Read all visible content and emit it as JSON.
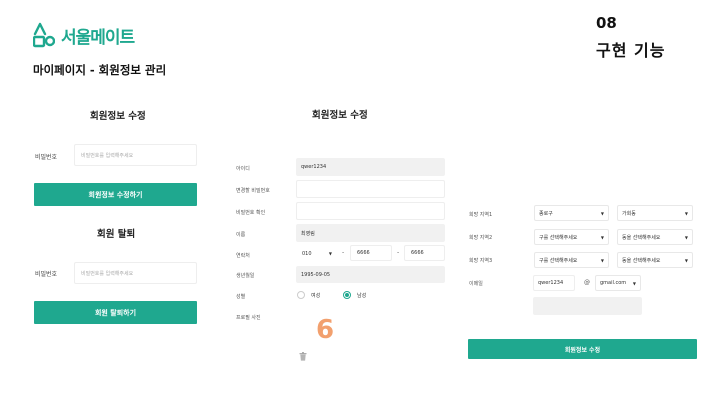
{
  "brand": {
    "name": "서울메이트",
    "color": "#1fa88f"
  },
  "page": {
    "subtitle": "마이페이지 - 회원정보 관리"
  },
  "badge": {
    "number": "08",
    "title": "구현 기능",
    "highlight": "#f6ee2e"
  },
  "left": {
    "edit": {
      "title": "회원정보 수정",
      "password_label": "비밀번호",
      "password_placeholder": "비밀번호를 입력해주세요",
      "button": "회원정보 수정하기"
    },
    "withdraw": {
      "title": "회원 탈퇴",
      "password_label": "비밀번호",
      "password_placeholder": "비밀번호를 입력해주세요",
      "button": "회원 탈퇴하기"
    }
  },
  "form": {
    "title": "회원정보 수정",
    "id_label": "아이디",
    "id_value": "qwer1234",
    "new_pw_label": "변경할 비밀번호",
    "confirm_pw_label": "비밀번호 확인",
    "name_label": "이름",
    "name_value": "최영림",
    "phone_label": "연락처",
    "phone_prefix": "010",
    "phone_mid": "6666",
    "phone_last": "6666",
    "phone_sep": "-",
    "birth_label": "생년월일",
    "birth_value": "1995-09-05",
    "gender_label": "성별",
    "gender_female": "여성",
    "gender_male": "남성",
    "gender_selected": "남성",
    "photo_label": "프로필 사진",
    "photo_marker": "6"
  },
  "region": {
    "region1_label": "희망 지역1",
    "region1_gu": "종로구",
    "region1_dong": "가회동",
    "region2_label": "희망 지역2",
    "region2_gu": "구를 선택해주세요",
    "region2_dong": "동을 선택해주세요",
    "region3_label": "희망 지역3",
    "region3_gu": "구를 선택해주세요",
    "region3_dong": "동을 선택해주세요",
    "email_label": "이메일",
    "email_id": "qwer1234",
    "email_at": "@",
    "email_domain": "gmail.com",
    "submit": "회원정보 수정"
  }
}
